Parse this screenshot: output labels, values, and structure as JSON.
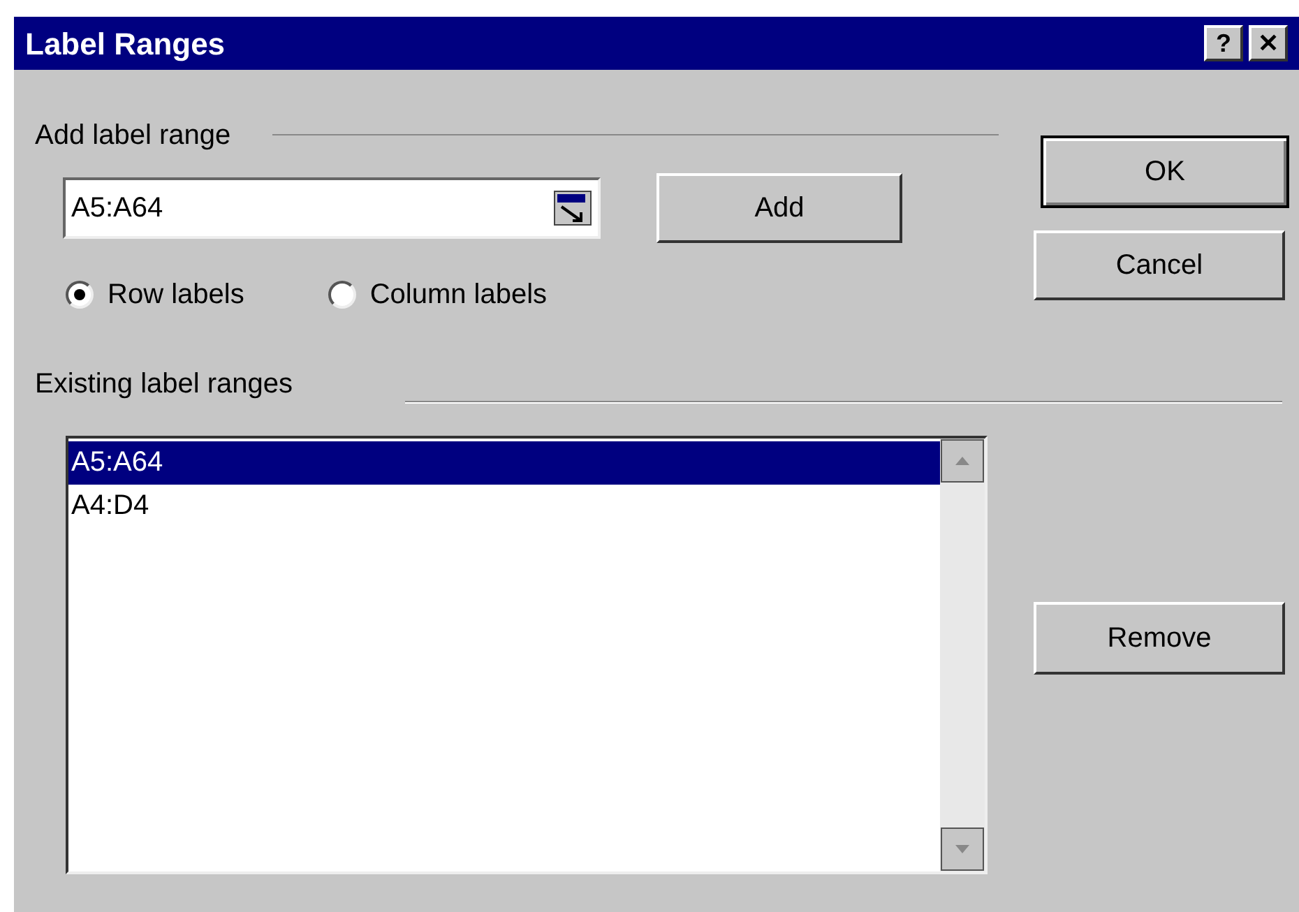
{
  "window": {
    "title": "Label Ranges",
    "buttons": [
      "?",
      "✕"
    ]
  },
  "add_group": {
    "label": "Add label range",
    "range_field": {
      "value": "A5:A64"
    },
    "add_button": "Add",
    "options": [
      {
        "label": "Row labels",
        "selected": true
      },
      {
        "label": "Column labels",
        "selected": false
      }
    ]
  },
  "existing_group": {
    "label": "Existing label ranges",
    "items": [
      {
        "label": "A5:A64",
        "selected": true
      },
      {
        "label": "A4:D4",
        "selected": false
      }
    ]
  },
  "buttons": {
    "ok": "OK",
    "cancel": "Cancel",
    "remove": "Remove"
  }
}
